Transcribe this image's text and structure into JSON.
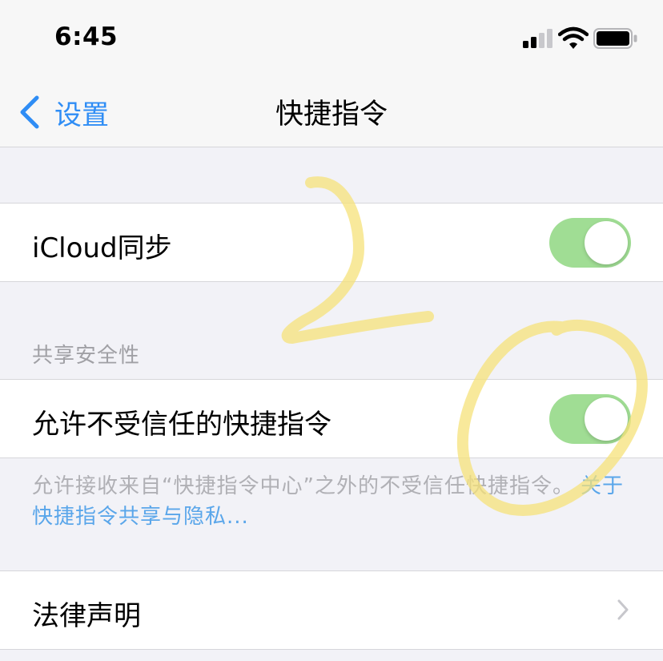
{
  "status_bar": {
    "time": "6:45",
    "signal_icon": "signal-icon",
    "wifi_icon": "wifi-icon",
    "battery_icon": "battery-icon"
  },
  "nav": {
    "back_label": "设置",
    "title": "快捷指令"
  },
  "rows": {
    "icloud_sync": {
      "label": "iCloud同步",
      "toggle_on": true
    },
    "untrusted": {
      "label": "允许不受信任的快捷指令",
      "toggle_on": true
    },
    "legal": {
      "label": "法律声明"
    }
  },
  "sharing_section": {
    "header": "共享安全性",
    "footer_text": "允许接收来自“快捷指令中心”之外的不受信任快捷指令。",
    "footer_link": "关于快捷指令共享与隐私..."
  },
  "colors": {
    "accent": "#2f8df5",
    "toggle_on": "#a0dd94",
    "annotation": "#f6e27a"
  }
}
